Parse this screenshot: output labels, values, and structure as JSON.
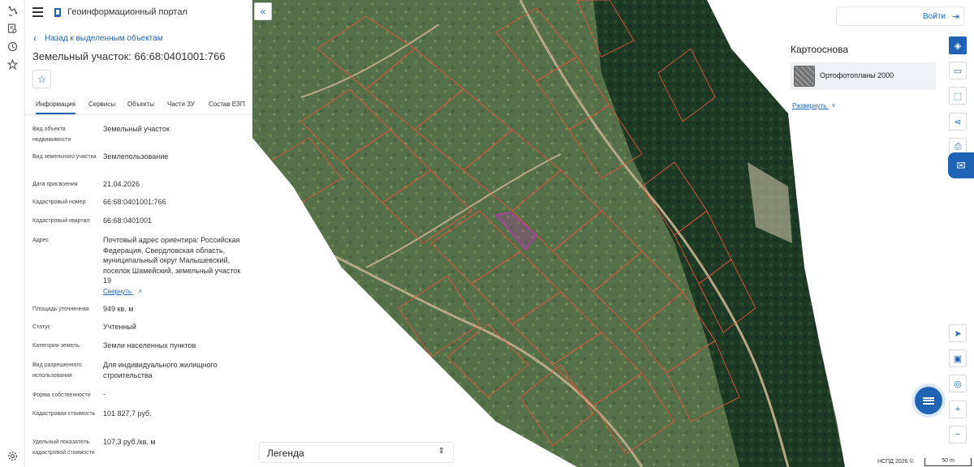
{
  "app": {
    "title": "Геоинформационный портал"
  },
  "panel": {
    "back_label": "Назад к выделенным объектам",
    "object_title": "Земельный участок: 66:68:0401001:766",
    "tabs": [
      "Информация",
      "Сервисы",
      "Объекты",
      "Части ЗУ",
      "Состав ЕЗП"
    ],
    "active_tab": "Информация",
    "fields": {
      "type_label": "Вид объекта недвижимости",
      "type_value": "Земельный участок",
      "land_kind_label": "Вид земельного участка",
      "land_kind_value": "Землепользование",
      "date_label": "Дата присвоения",
      "date_value": "21.04.2026",
      "cadnum_label": "Кадастровый номер",
      "cadnum_value": "66:68:0401001:766",
      "quarter_label": "Кадастровый квартал",
      "quarter_value": "66:68:0401001",
      "address_label": "Адрес",
      "address_value": "Почтовый адрес ориентира: Российская Федерация, Свердловская область, муниципальный округ Малышевский, поселок Шамейский, земельный участок 19",
      "collapse_label": "Свернуть",
      "area_label": "Площадь уточненная",
      "area_value": "949 кв. м",
      "status_label": "Статус",
      "status_value": "Учтенный",
      "category_label": "Категория земель",
      "category_value": "Земли населенных пунктов",
      "usage_label": "Вид разрешенного использования",
      "usage_value": "Для индивидуального жилищного строительства",
      "ownership_label": "Форма собственности",
      "ownership_value": "-",
      "cost_label": "Кадастровая стоимость",
      "cost_value": "101 827,7 руб.",
      "unit_cost_label": "Удельный показатель кадастровой стоимости",
      "unit_cost_value": "107,3 руб./кв. м"
    }
  },
  "map": {
    "login_label": "Войти",
    "basemap_header": "Картооснова",
    "basemap_card_title": "Ортофотопланы 2000",
    "basemap_expand_label": "Развернуть",
    "legend_label": "Легенда",
    "attribution": "НСПД 2026 ©",
    "scale_label": "50 m",
    "colors": {
      "accent": "#1f64b4",
      "parcel_border": "#e0533d",
      "selected_parcel": "#b03aa8",
      "forest": "#1f3a24"
    }
  },
  "icons": {
    "rail": [
      "layers-icon",
      "document-search-icon",
      "history-icon",
      "star-icon",
      "settings-icon"
    ],
    "right_toolbar": [
      "layers-panel-icon",
      "ruler-icon",
      "select-area-icon",
      "share-icon",
      "print-icon",
      "chat-icon",
      "navigation-icon",
      "map-view-icon",
      "locate-icon",
      "zoom-in-icon",
      "zoom-out-icon"
    ]
  }
}
